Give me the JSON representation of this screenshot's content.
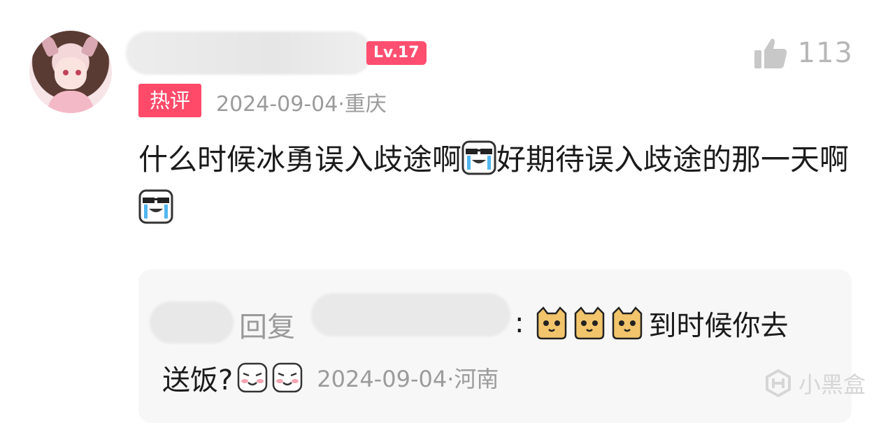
{
  "comment": {
    "level_badge": "Lv.17",
    "like_count": "113",
    "hot_label": "热评",
    "meta": "2024-09-04·重庆",
    "text_part1": "什么时候冰勇误入歧途啊",
    "text_part2": "好期待误入歧途的那一天啊",
    "emoji_names": [
      "crying-laughing-sunglasses-icon",
      "crying-laughing-sunglasses-icon"
    ]
  },
  "reply": {
    "reply_word": "回复",
    "colon": ":",
    "text_part1": "到时候你去",
    "text_part2": "送饭?",
    "meta": "2024-09-04·河南",
    "emoji_names": [
      "cat-face-icon",
      "cat-face-icon",
      "cat-face-icon",
      "blush-face-icon",
      "blush-face-icon"
    ]
  },
  "watermark": {
    "text": "小黑盒"
  },
  "colors": {
    "accent_pink": "#ff4a6a",
    "muted_gray": "#9b9b9b",
    "reply_bg": "#f7f7f8"
  }
}
